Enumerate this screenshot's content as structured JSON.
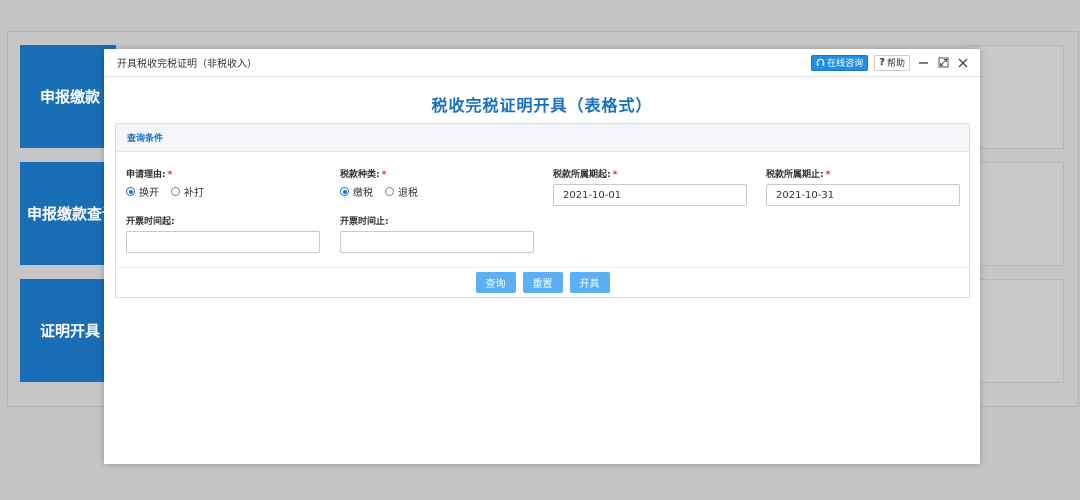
{
  "background": {
    "tiles": [
      {
        "label": "申报缴款"
      },
      {
        "label": "申报缴款查询"
      },
      {
        "label": "证明开具"
      }
    ]
  },
  "modal": {
    "title": "开具税收完税证明（非税收入）",
    "tools": {
      "online_label": "在线咨询",
      "help_q": "?",
      "help_label": "帮助"
    },
    "main_title": "税收完税证明开具（表格式）",
    "panel_title": "查询条件",
    "fields": {
      "reason": {
        "label": "申请理由:",
        "required": "*",
        "options": [
          {
            "label": "换开",
            "selected": true
          },
          {
            "label": "补打",
            "selected": false
          }
        ]
      },
      "tax_type": {
        "label": "税款种类:",
        "required": "*",
        "options": [
          {
            "label": "缴税",
            "selected": true
          },
          {
            "label": "退税",
            "selected": false
          }
        ]
      },
      "period_start": {
        "label": "税款所属期起:",
        "required": "*",
        "value": "2021-10-01"
      },
      "period_end": {
        "label": "税款所属期止:",
        "required": "*",
        "value": "2021-10-31"
      },
      "issue_start": {
        "label": "开票时间起:",
        "value": ""
      },
      "issue_end": {
        "label": "开票时间止:",
        "value": ""
      }
    },
    "buttons": {
      "query": "查询",
      "reset": "重置",
      "issue": "开具"
    }
  },
  "colors": {
    "accent": "#1670c1",
    "tile": "#1a6eb5",
    "button": "#5ab0f2",
    "online_button": "#1f8fe6",
    "required": "#e02020"
  }
}
